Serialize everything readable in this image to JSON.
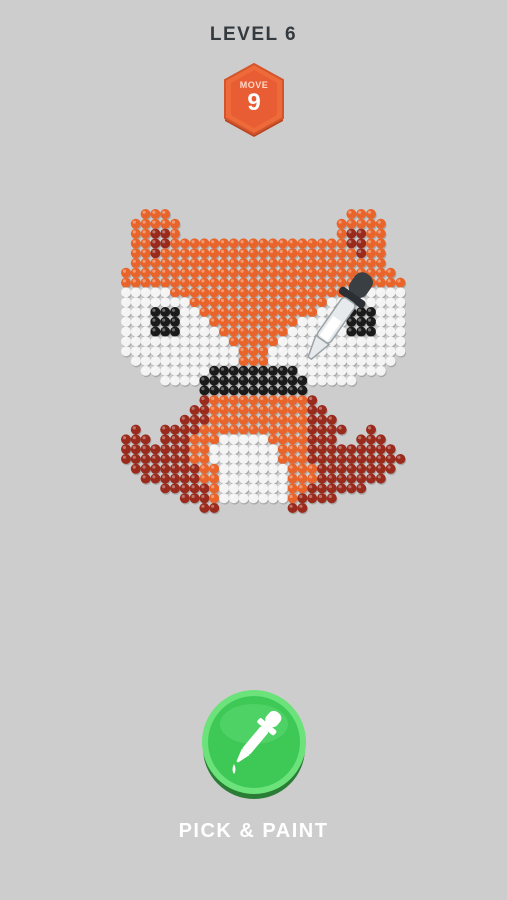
{
  "level": {
    "title": "LEVEL 6"
  },
  "moves": {
    "label": "MOVE",
    "count": "9"
  },
  "action": {
    "label": "PICK & PAINT",
    "icon": "eyedropper-icon"
  },
  "colors": {
    "background": "#cdcdcd",
    "orange": "#e9642a",
    "dark_red": "#9a2a1c",
    "white": "#f4f4f4",
    "black": "#1a1a1a",
    "badge": "#e85d33",
    "button": "#39c553"
  },
  "fox_pattern": {
    "legend": {
      "O": "orange",
      "R": "dark_red",
      "W": "white",
      "K": "black"
    }
  }
}
